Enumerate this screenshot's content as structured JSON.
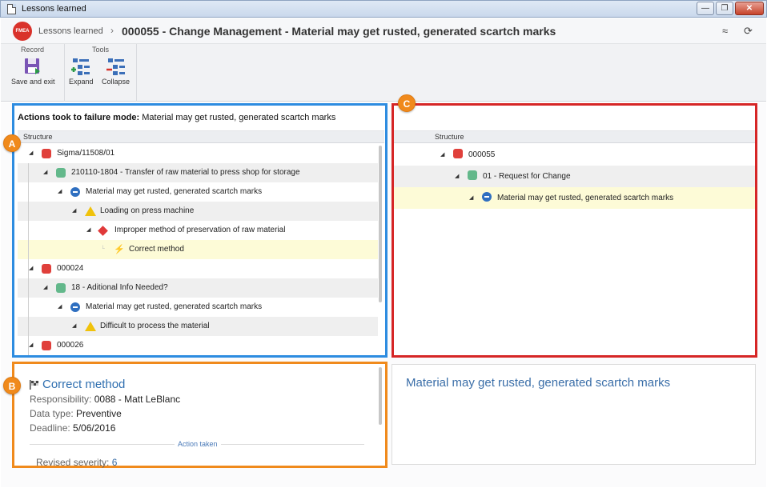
{
  "window": {
    "title": "Lessons learned",
    "buttons": [
      "—",
      "❐",
      "✕"
    ]
  },
  "header": {
    "logo": "FMEA",
    "breadcrumb": "Lessons learned",
    "separator": "›",
    "title": "000055 - Change Management - Material may get rusted, generated scartch marks",
    "collapse_icon": "≈",
    "refresh_icon": "⟳"
  },
  "ribbon": {
    "groups": [
      {
        "label": "Record",
        "buttons": [
          {
            "label": "Save and exit",
            "icon": "save-exit-icon"
          }
        ]
      },
      {
        "label": "Tools",
        "buttons": [
          {
            "label": "Expand",
            "icon": "expand-icon"
          },
          {
            "label": "Collapse",
            "icon": "collapse-icon"
          }
        ]
      }
    ]
  },
  "markers": {
    "a": "A",
    "b": "B",
    "c": "C"
  },
  "left_panel": {
    "title_bold": "Actions took to failure mode:",
    "title_rest": " Material may get rusted, generated scartch marks",
    "column": "Structure",
    "rows": [
      {
        "label": "Sigma/11508/01",
        "icon": "node-red",
        "level": 0
      },
      {
        "label": "210110-1804 - Transfer of raw material to press shop for storage",
        "icon": "node-green",
        "level": 1
      },
      {
        "label": "Material may get rusted, generated scartch marks",
        "icon": "minus-blue",
        "level": 2
      },
      {
        "label": "Loading on press machine",
        "icon": "warn",
        "level": 3
      },
      {
        "label": "Improper method of preservation of raw material",
        "icon": "diamond",
        "level": 4
      },
      {
        "label": "Correct method",
        "icon": "bolt",
        "level": 5
      },
      {
        "label": "000024",
        "icon": "node-red",
        "level": 0
      },
      {
        "label": "18 - Aditional Info Needed?",
        "icon": "node-green",
        "level": 1
      },
      {
        "label": "Material may get rusted, generated scartch marks",
        "icon": "minus-blue",
        "level": 2
      },
      {
        "label": "Difficult to process the material",
        "icon": "warn",
        "level": 3
      },
      {
        "label": "000026",
        "icon": "node-red",
        "level": 0
      }
    ]
  },
  "right_panel": {
    "column": "Structure",
    "rows": [
      {
        "label": "000055",
        "icon": "node-red"
      },
      {
        "label": "01 - Request for Change",
        "icon": "node-green"
      },
      {
        "label": "Material may get rusted, generated scartch marks",
        "icon": "minus-blue"
      }
    ]
  },
  "detail": {
    "title": "Correct method",
    "responsibility_label": "Responsibility:",
    "responsibility": "0088 - Matt LeBlanc",
    "datatype_label": "Data type:",
    "datatype": "Preventive",
    "deadline_label": "Deadline:",
    "deadline": "5/06/2016",
    "divider_label": "Action taken",
    "severity_label": "Revised severity:",
    "severity": "6"
  },
  "right_detail": {
    "title": "Material may get rusted, generated scartch marks"
  },
  "colors": {
    "panel_a": "#2d8ce0",
    "panel_b": "#f08a1c",
    "panel_c": "#d62626",
    "selected_row": "#fdfbd7"
  }
}
